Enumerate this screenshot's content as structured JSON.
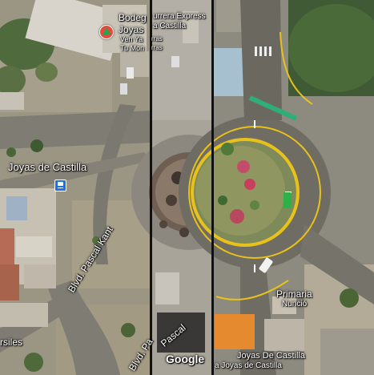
{
  "map": {
    "labels": {
      "neighborhood_left": "Joyas de Castilla",
      "street_kant_upper": "Blvd. Pascal Kant",
      "street_kant_lower": "Blvd. Pa",
      "street_pascal_mid": "Pascal",
      "street_versailles": "rsiles",
      "school": "Primaria",
      "school_line2": "Nunció",
      "neighborhood_right": "Joyas De Castilla",
      "neighborhood_right_sub": "a Joyas de Castilla"
    },
    "poi": {
      "name_line1": "Bodeg",
      "name_line2": "Joyas",
      "name_line3": "Ven Ya",
      "name_line4": "Tu Mon",
      "courier_line1": "urrera Express",
      "courier_line2": "a Castilla",
      "courier_sub1": "rras",
      "courier_sub2": "rras"
    },
    "attribution": "Google",
    "icons": {
      "poi": "store-marker-icon",
      "transit": "bus-stop-icon"
    },
    "colors": {
      "road": "#7f7c74",
      "roundabout_marking": "#e8c21a",
      "bike_lane": "#2fae7a",
      "divider": "#111111"
    }
  }
}
